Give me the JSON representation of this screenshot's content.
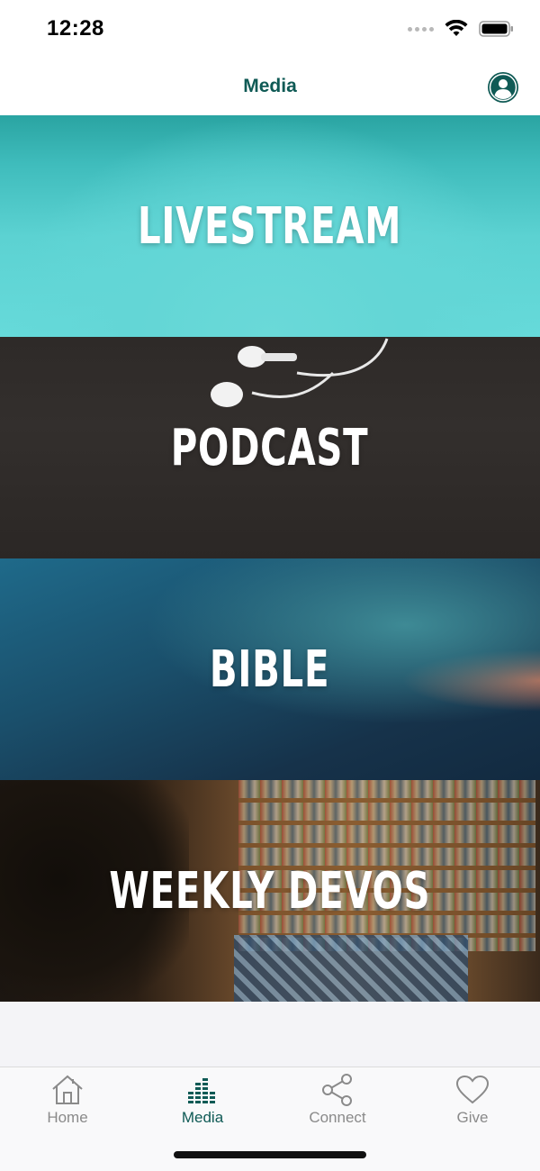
{
  "status_bar": {
    "time": "12:28"
  },
  "nav": {
    "title": "Media",
    "profile_icon": "person-circle-icon"
  },
  "tiles": [
    {
      "title": "LIVESTREAM"
    },
    {
      "title": "PODCAST"
    },
    {
      "title": "BIBLE"
    },
    {
      "title": "WEEKLY DEVOS"
    }
  ],
  "tab_bar": {
    "items": [
      {
        "label": "Home",
        "icon": "home-icon"
      },
      {
        "label": "Media",
        "icon": "equalizer-icon",
        "active": true
      },
      {
        "label": "Connect",
        "icon": "share-icon"
      },
      {
        "label": "Give",
        "icon": "heart-icon"
      }
    ]
  },
  "colors": {
    "accent": "#0f5a55",
    "livestream_bg": "#5cd2d2",
    "inactive_tab": "#8a8a8a"
  }
}
